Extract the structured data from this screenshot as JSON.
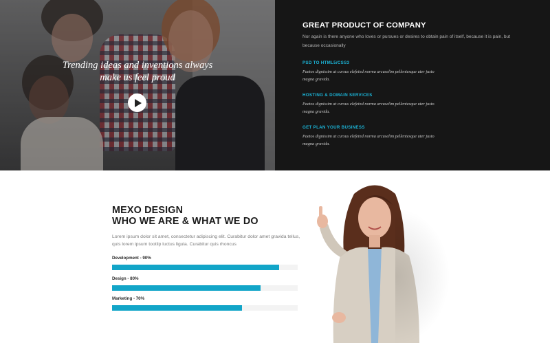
{
  "hero": {
    "tagline": "Trending ideas and inventions always\nmake us feel proud",
    "play_icon": "play-icon"
  },
  "panel": {
    "title": "GREAT PRODUCT OF COMPANY",
    "description": "Nor again is there anyone who loves or pursues or desires to obtain pain of itself, because it is pain, but because occasionally",
    "services": [
      {
        "title": "PSD TO HTML5/CSS3",
        "text": "Paetos dignissim at cursus elefeind norma arcuselim pellentesque uter justo magna gravida."
      },
      {
        "title": "HOSTING & DOMAIN SERVICES",
        "text": "Paetos dignissim at cursus elefeind norma arcuselim pellentesque uter justo magna gravida."
      },
      {
        "title": "GET PLAN YOUR BUSINESS",
        "text": "Paetos dignissim at cursus elefeind norma arcuselim pellentesque uter justo magna gravida."
      }
    ]
  },
  "about": {
    "heading_line1": "MEXO DESIGN",
    "heading_line2": "WHO WE ARE & WHAT WE DO",
    "text": "Lorem ipsum dolor sit amet, consectetur adipiscing elit. Curabitur dolor amet gravida tellus, quis lorem ipsum tootlip luctus ligula. Curabitur quis rhoncus",
    "skills": [
      {
        "label": "Development - 90%",
        "percent": 90
      },
      {
        "label": "Design - 80%",
        "percent": 80
      },
      {
        "label": "Marketing - 70%",
        "percent": 70
      }
    ]
  },
  "colors": {
    "accent": "#12a5c8",
    "panel_bg": "#161616"
  }
}
